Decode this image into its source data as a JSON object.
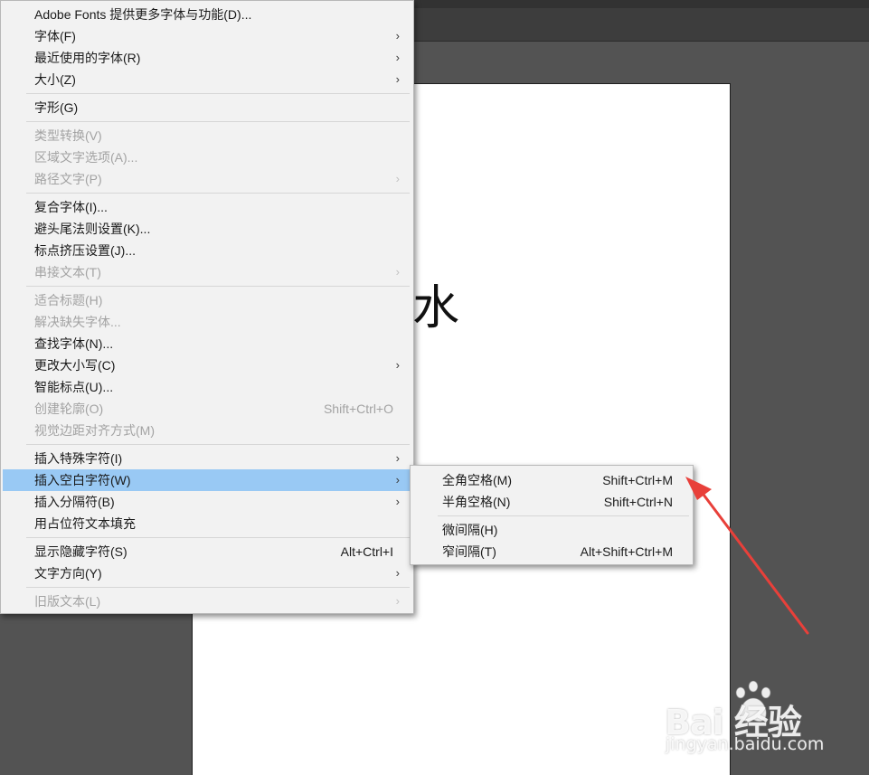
{
  "canvas": {
    "artboard_text": "长江东逝水"
  },
  "main_menu": {
    "items": [
      {
        "label": "Adobe Fonts 提供更多字体与功能(D)...",
        "enabled": true
      },
      {
        "label": "字体(F)",
        "enabled": true,
        "submenu": true
      },
      {
        "label": "最近使用的字体(R)",
        "enabled": true,
        "submenu": true
      },
      {
        "label": "大小(Z)",
        "enabled": true,
        "submenu": true
      },
      {
        "label": "字形(G)",
        "enabled": true
      },
      {
        "label": "类型转换(V)",
        "enabled": false
      },
      {
        "label": "区域文字选项(A)...",
        "enabled": false
      },
      {
        "label": "路径文字(P)",
        "enabled": false,
        "submenu": true
      },
      {
        "label": "复合字体(I)...",
        "enabled": true
      },
      {
        "label": "避头尾法则设置(K)...",
        "enabled": true
      },
      {
        "label": "标点挤压设置(J)...",
        "enabled": true
      },
      {
        "label": "串接文本(T)",
        "enabled": false,
        "submenu": true
      },
      {
        "label": "适合标题(H)",
        "enabled": false
      },
      {
        "label": "解决缺失字体...",
        "enabled": false
      },
      {
        "label": "查找字体(N)...",
        "enabled": true
      },
      {
        "label": "更改大小写(C)",
        "enabled": true,
        "submenu": true
      },
      {
        "label": "智能标点(U)...",
        "enabled": true
      },
      {
        "label": "创建轮廓(O)",
        "enabled": false,
        "shortcut": "Shift+Ctrl+O"
      },
      {
        "label": "视觉边距对齐方式(M)",
        "enabled": false
      },
      {
        "label": "插入特殊字符(I)",
        "enabled": true,
        "submenu": true
      },
      {
        "label": "插入空白字符(W)",
        "enabled": true,
        "submenu": true,
        "highlighted": true
      },
      {
        "label": "插入分隔符(B)",
        "enabled": true,
        "submenu": true
      },
      {
        "label": "用占位符文本填充",
        "enabled": true
      },
      {
        "label": "显示隐藏字符(S)",
        "enabled": true,
        "shortcut": "Alt+Ctrl+I"
      },
      {
        "label": "文字方向(Y)",
        "enabled": true,
        "submenu": true
      },
      {
        "label": "旧版文本(L)",
        "enabled": false,
        "submenu": true
      }
    ]
  },
  "sub_menu": {
    "items": [
      {
        "label": "全角空格(M)",
        "shortcut": "Shift+Ctrl+M"
      },
      {
        "label": "半角空格(N)",
        "shortcut": "Shift+Ctrl+N"
      },
      {
        "label": "微间隔(H)",
        "shortcut": ""
      },
      {
        "label": "窄间隔(T)",
        "shortcut": "Alt+Shift+Ctrl+M"
      }
    ]
  },
  "watermark": {
    "logo_text": "Bai  经验",
    "url": "jingyan.baidu.com"
  },
  "colors": {
    "highlight": "#99c9f4",
    "annotation_arrow": "#e8403a",
    "workspace": "#535353"
  },
  "icons": {
    "submenu_arrow": "chevron-right-icon"
  }
}
